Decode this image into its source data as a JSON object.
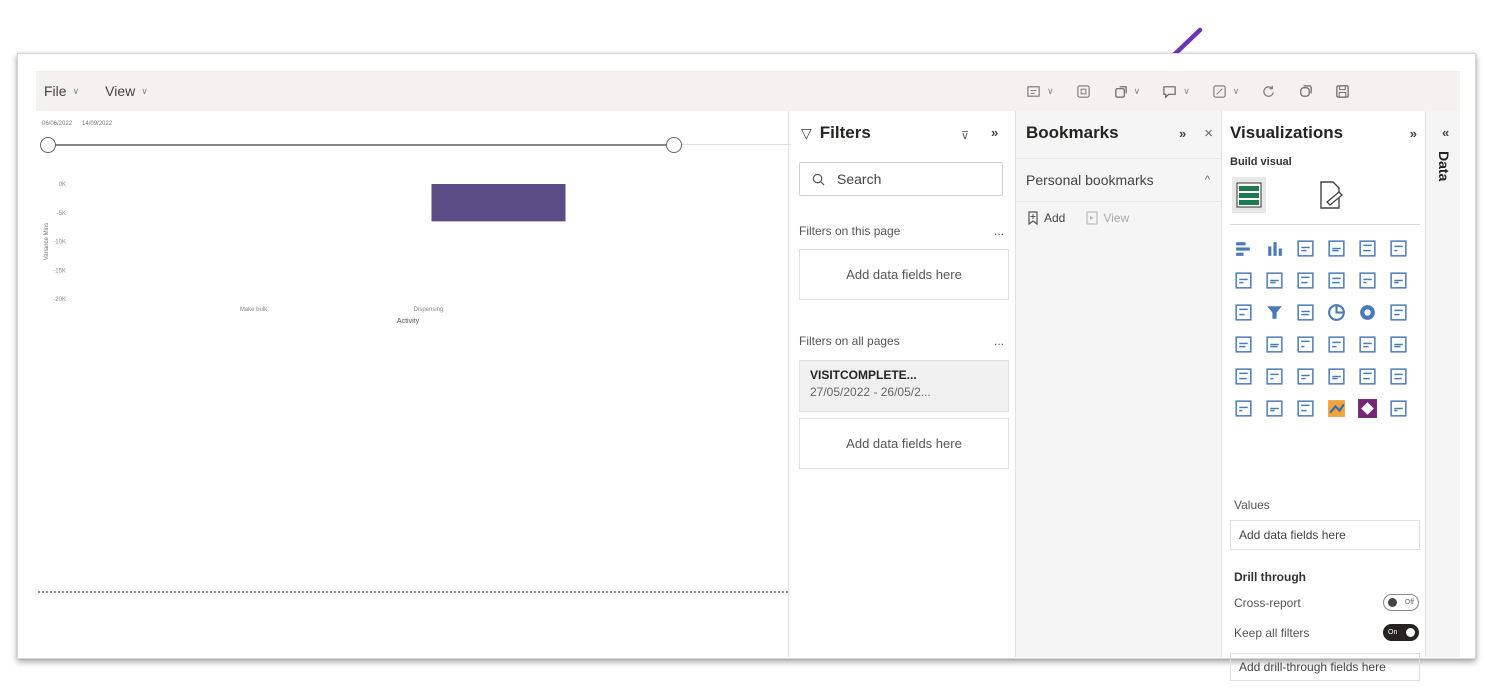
{
  "menu": {
    "file": "File",
    "view": "View"
  },
  "canvas": {
    "date_start": "06/06/2022",
    "date_end": "14/09/2022"
  },
  "chart_data": {
    "type": "bar",
    "categories": [
      "Make bulk",
      "Dispensing"
    ],
    "values": [
      0,
      -6.5
    ],
    "xlabel": "Activity",
    "ylabel": "Variance Mins",
    "yticks": [
      "0K",
      "-5K",
      "-10K",
      "-15K",
      "-20K"
    ],
    "ylim": [
      -20,
      0
    ],
    "bar_color": "#5c4c86"
  },
  "filters": {
    "title": "Filters",
    "search_placeholder": "Search",
    "this_page_label": "Filters on this page",
    "this_page_more": "...",
    "add_fields_1": "Add data fields here",
    "all_pages_label": "Filters on all pages",
    "all_pages_more": "...",
    "card_name": "VISITCOMPLETE...",
    "card_value": "27/05/2022 - 26/05/2...",
    "add_fields_2": "Add data fields here"
  },
  "bookmarks": {
    "title": "Bookmarks",
    "expand": "»",
    "close": "×",
    "section": "Personal bookmarks",
    "section_chevron": "^",
    "add_label": "Add",
    "view_label": "View"
  },
  "visualizations": {
    "title": "Visualizations",
    "expand": "»",
    "build_visual": "Build visual",
    "values_label": "Values",
    "values_placeholder": "Add data fields here",
    "drill_through": "Drill through",
    "cross_report": "Cross-report",
    "cross_report_state": "Off",
    "keep_all_filters": "Keep all filters",
    "keep_all_filters_state": "On",
    "drill_placeholder": "Add drill-through fields here"
  },
  "data_pane": {
    "label": "Data",
    "collapse": "«"
  },
  "colors": {
    "accent": "#5c4c86",
    "arrow": "#6b35b5",
    "chrome": "#f3f2f1"
  }
}
